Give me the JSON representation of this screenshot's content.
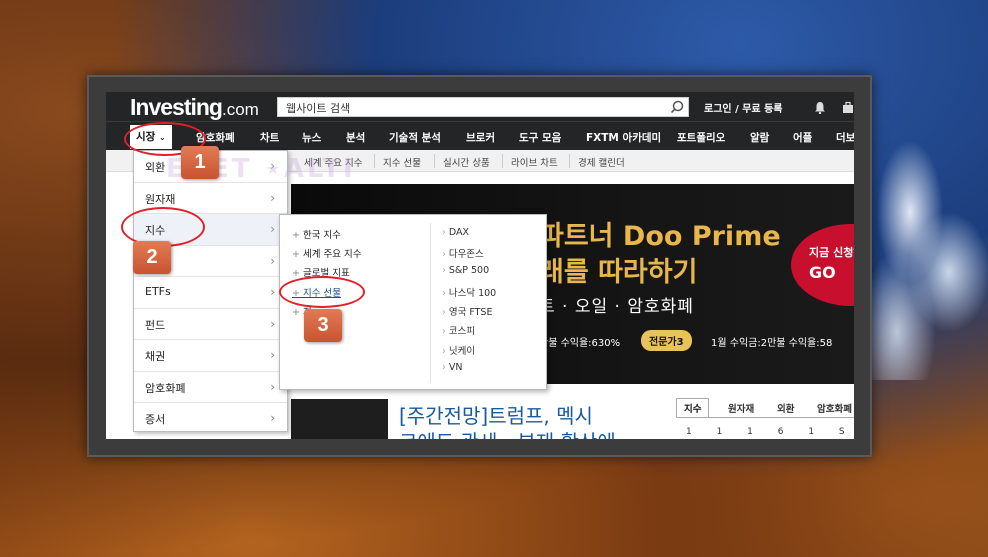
{
  "header": {
    "logo_text": "Investing",
    "logo_suffix": ".com",
    "search_placeholder": "웹사이트 검색",
    "login_label": "로그인 / 무료 등록"
  },
  "nav": {
    "items": [
      "시장",
      "암호화폐",
      "차트",
      "뉴스",
      "분석",
      "기술적 분석",
      "브로커",
      "도구 모음",
      "FXTM 아카데미",
      "포트폴리오",
      "알람",
      "어플",
      "더보"
    ]
  },
  "subnav": {
    "items": [
      "세계 주요 지수",
      "지수 선물",
      "실시간 상품",
      "라이브 차트",
      "경제 캘린더"
    ]
  },
  "dropdown": {
    "items": [
      "외환",
      "원자재",
      "지수",
      "",
      "ETFs",
      "펀드",
      "채권",
      "암호화폐",
      "증서"
    ]
  },
  "submenu": {
    "left": [
      "한국 지수",
      "세계 주요 지수",
      "글로벌 지표",
      "지수 선물",
      "지"
    ],
    "right": [
      "DAX",
      "다우존스",
      "S&P 500",
      "나스닥 100",
      "영국 FTSE",
      "코스피",
      "닛케이",
      "VN"
    ]
  },
  "banner": {
    "title": "파트너 Doo Prime",
    "subtitle": "래를 따라하기",
    "subtitle2": "트 · 오일 · 암호화폐",
    "line1": "만불 수익율:630%",
    "badge": "전문가3",
    "line2": "1월 수익금:2만불 수익율:58",
    "cta_text": "지금 신청해",
    "cta_go": "GO"
  },
  "watermark": "EGET ⋆ALTI",
  "news": {
    "title_line1": "[주간전망]트럼프, 멕시",
    "title_line2": "코에도 관세…부재 확산에"
  },
  "market_tabs": {
    "items": [
      "지수",
      "원자재",
      "외환",
      "암호화폐"
    ],
    "row": "1 1 1 6 1 S"
  },
  "steps": [
    "1",
    "2",
    "3"
  ]
}
